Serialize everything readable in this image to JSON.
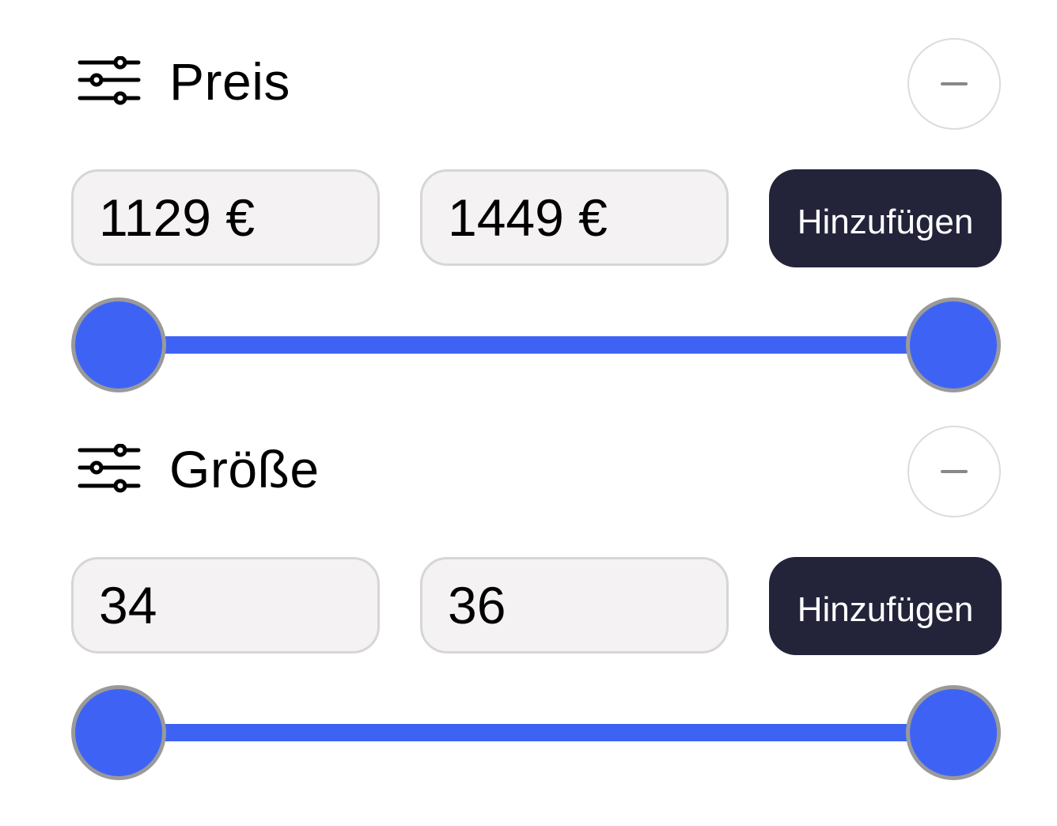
{
  "filters": {
    "price": {
      "title": "Preis",
      "icon": "sliders-icon",
      "collapse_icon": "minus-icon",
      "min_value": "1129 €",
      "max_value": "1449 €",
      "add_label": "Hinzufügen",
      "slider_min_fraction": 0.0,
      "slider_max_fraction": 1.0
    },
    "size": {
      "title": "Größe",
      "icon": "sliders-icon",
      "collapse_icon": "minus-icon",
      "min_value": "34",
      "max_value": "36",
      "add_label": "Hinzufügen",
      "slider_min_fraction": 0.0,
      "slider_max_fraction": 1.0
    }
  },
  "colors": {
    "accent": "#3e63f4",
    "button_bg": "#23243a",
    "input_bg": "#f4f2f3",
    "input_border": "#d6d6d6"
  }
}
